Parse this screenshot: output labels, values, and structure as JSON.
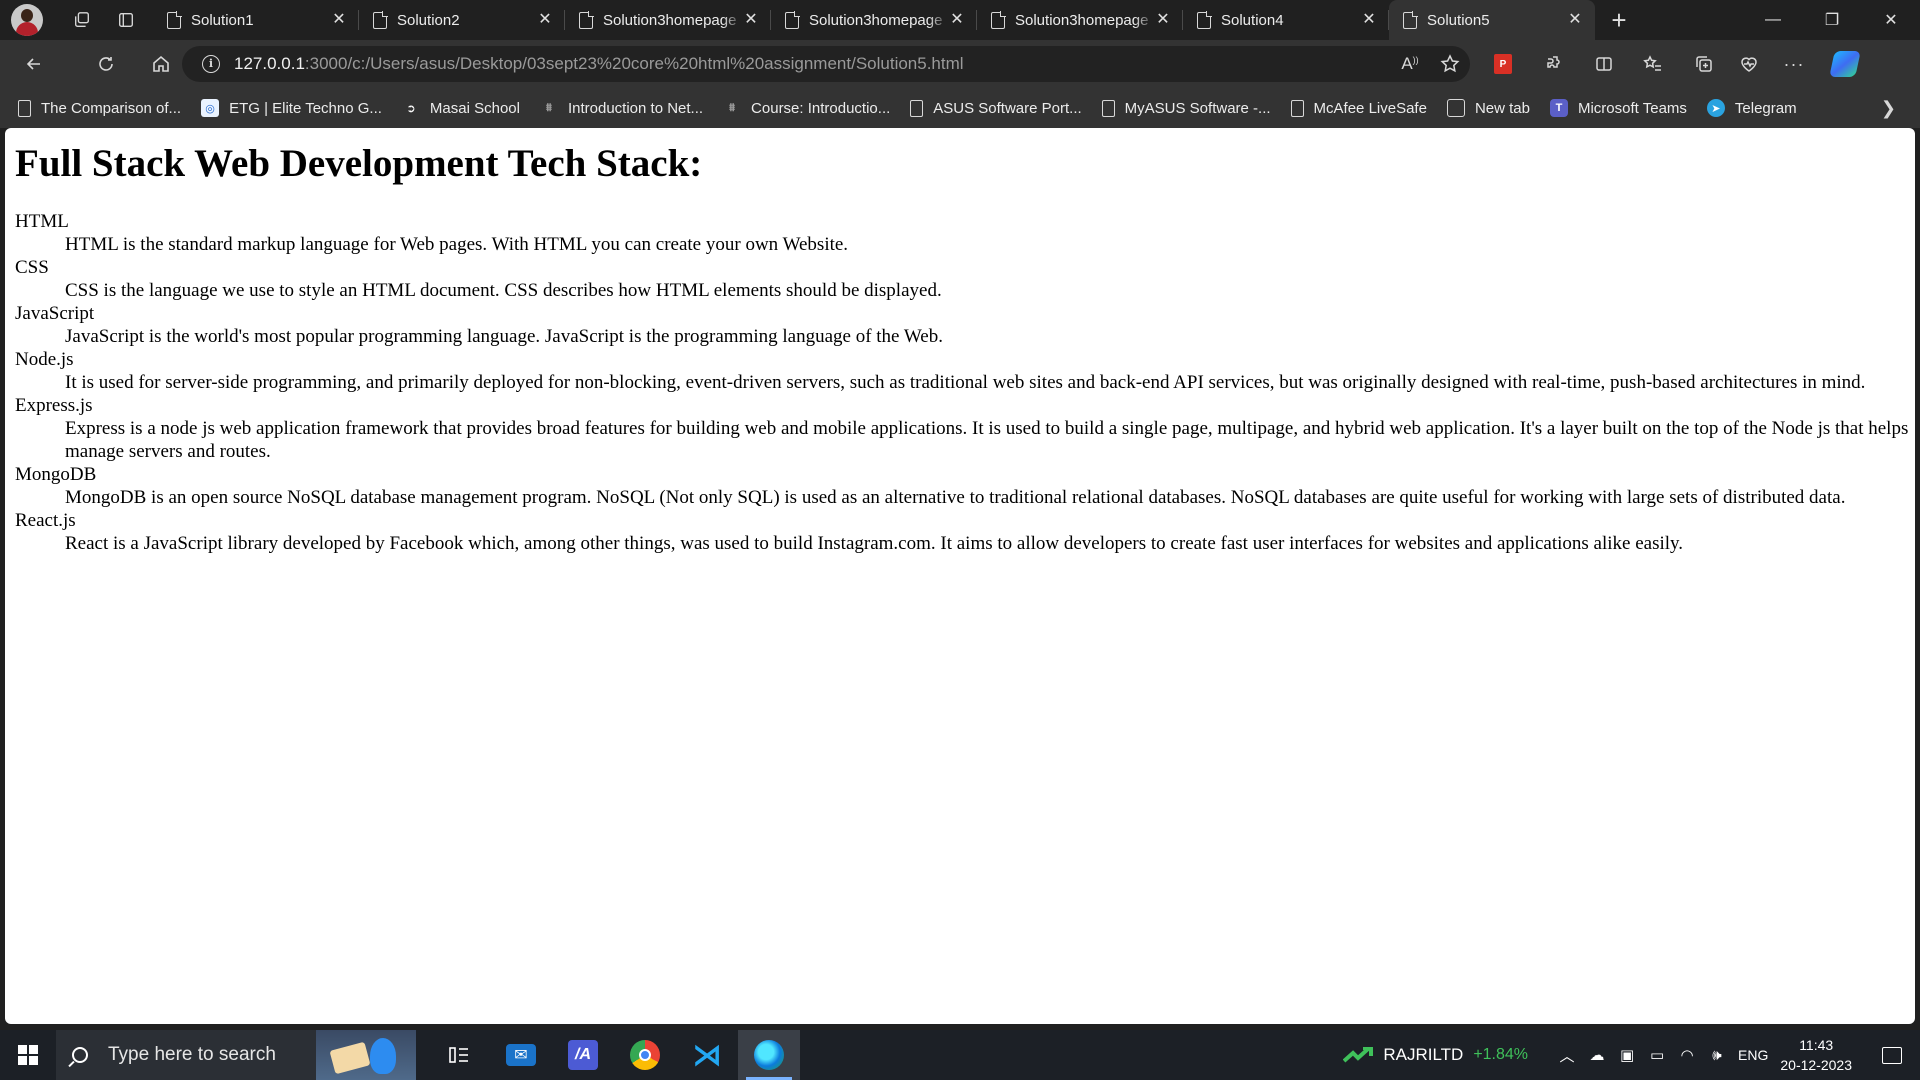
{
  "browser": {
    "tabs": [
      {
        "title": "Solution1",
        "active": false
      },
      {
        "title": "Solution2",
        "active": false
      },
      {
        "title": "Solution3homepage",
        "active": false
      },
      {
        "title": "Solution3homepage",
        "active": false
      },
      {
        "title": "Solution3homepage",
        "active": false
      },
      {
        "title": "Solution4",
        "active": false
      },
      {
        "title": "Solution5",
        "active": true
      }
    ],
    "close_glyph": "✕",
    "new_tab_glyph": "+",
    "window": {
      "minimize": "—",
      "restore": "❐",
      "close": "✕"
    },
    "address": {
      "host": "127.0.0.1",
      "rest": ":3000/c:/Users/asus/Desktop/03sept23%20core%20html%20assignment/Solution5.html"
    },
    "read_aloud_label": "A",
    "extension_badge": "P",
    "favorites": [
      {
        "label": "The Comparison of...",
        "icon": "doc-icon"
      },
      {
        "label": "ETG | Elite Techno G...",
        "icon": "etg-icon"
      },
      {
        "label": "Masai School",
        "icon": "masai-icon"
      },
      {
        "label": "Introduction to Net...",
        "icon": "course-icon"
      },
      {
        "label": "Course: Introductio...",
        "icon": "course-icon"
      },
      {
        "label": "ASUS Software Port...",
        "icon": "doc-icon"
      },
      {
        "label": "MyASUS Software -...",
        "icon": "doc-icon"
      },
      {
        "label": "McAfee LiveSafe",
        "icon": "doc-icon"
      },
      {
        "label": "New tab",
        "icon": "newtab-icon"
      },
      {
        "label": "Microsoft Teams",
        "icon": "teams-icon"
      },
      {
        "label": "Telegram",
        "icon": "telegram-icon"
      }
    ]
  },
  "page": {
    "heading": "Full Stack Web Development Tech Stack:",
    "items": [
      {
        "term": "HTML",
        "desc": "HTML is the standard markup language for Web pages. With HTML you can create your own Website."
      },
      {
        "term": "CSS",
        "desc": "CSS is the language we use to style an HTML document. CSS describes how HTML elements should be displayed."
      },
      {
        "term": "JavaScript",
        "desc": "JavaScript is the world's most popular programming language. JavaScript is the programming language of the Web."
      },
      {
        "term": "Node.js",
        "desc": "It is used for server-side programming, and primarily deployed for non-blocking, event-driven servers, such as traditional web sites and back-end API services, but was originally designed with real-time, push-based architectures in mind."
      },
      {
        "term": "Express.js",
        "desc": "Express is a node js web application framework that provides broad features for building web and mobile applications. It is used to build a single page, multipage, and hybrid web application. It's a layer built on the top of the Node js that helps manage servers and routes."
      },
      {
        "term": "MongoDB",
        "desc": "MongoDB is an open source NoSQL database management program. NoSQL (Not only SQL) is used as an alternative to traditional relational databases. NoSQL databases are quite useful for working with large sets of distributed data."
      },
      {
        "term": "React.js",
        "desc": "React is a JavaScript library developed by Facebook which, among other things, was used to build Instagram.com. It aims to allow developers to create fast user interfaces for websites and applications alike easily."
      }
    ]
  },
  "taskbar": {
    "search_placeholder": "Type here to search",
    "stock": {
      "symbol": "RAJRILTD",
      "change": "+1.84%",
      "color": "#3fc15a"
    },
    "language": "ENG",
    "time": "11:43",
    "date": "20-12-2023"
  },
  "colors": {
    "accent": "#7ab3ff",
    "page_bg": "#ffffff",
    "chrome_bg": "#333333"
  }
}
